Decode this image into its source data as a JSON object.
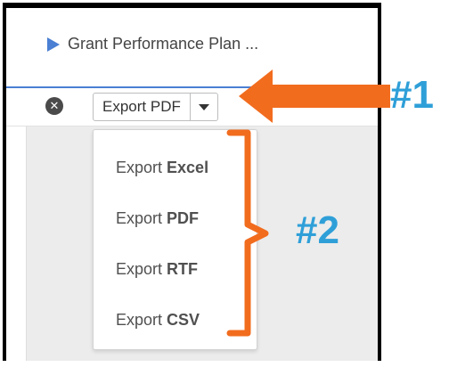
{
  "tab": {
    "title": "Grant Performance Plan ..."
  },
  "toolbar": {
    "export_button_label": "Export PDF"
  },
  "export_menu": {
    "items": [
      {
        "prefix": "Export ",
        "format": "Excel"
      },
      {
        "prefix": "Export ",
        "format": "PDF"
      },
      {
        "prefix": "Export ",
        "format": "RTF"
      },
      {
        "prefix": "Export ",
        "format": "CSV"
      }
    ]
  },
  "annotations": {
    "label_1": "#1",
    "label_2": "#2"
  },
  "colors": {
    "accent_blue": "#4a7fd3",
    "annotation_orange": "#f26c1e",
    "annotation_blue": "#2f9fd8"
  },
  "icons": {
    "tab": "play-triangle-icon",
    "close": "close-circle-icon",
    "dropdown": "caret-down-icon"
  }
}
